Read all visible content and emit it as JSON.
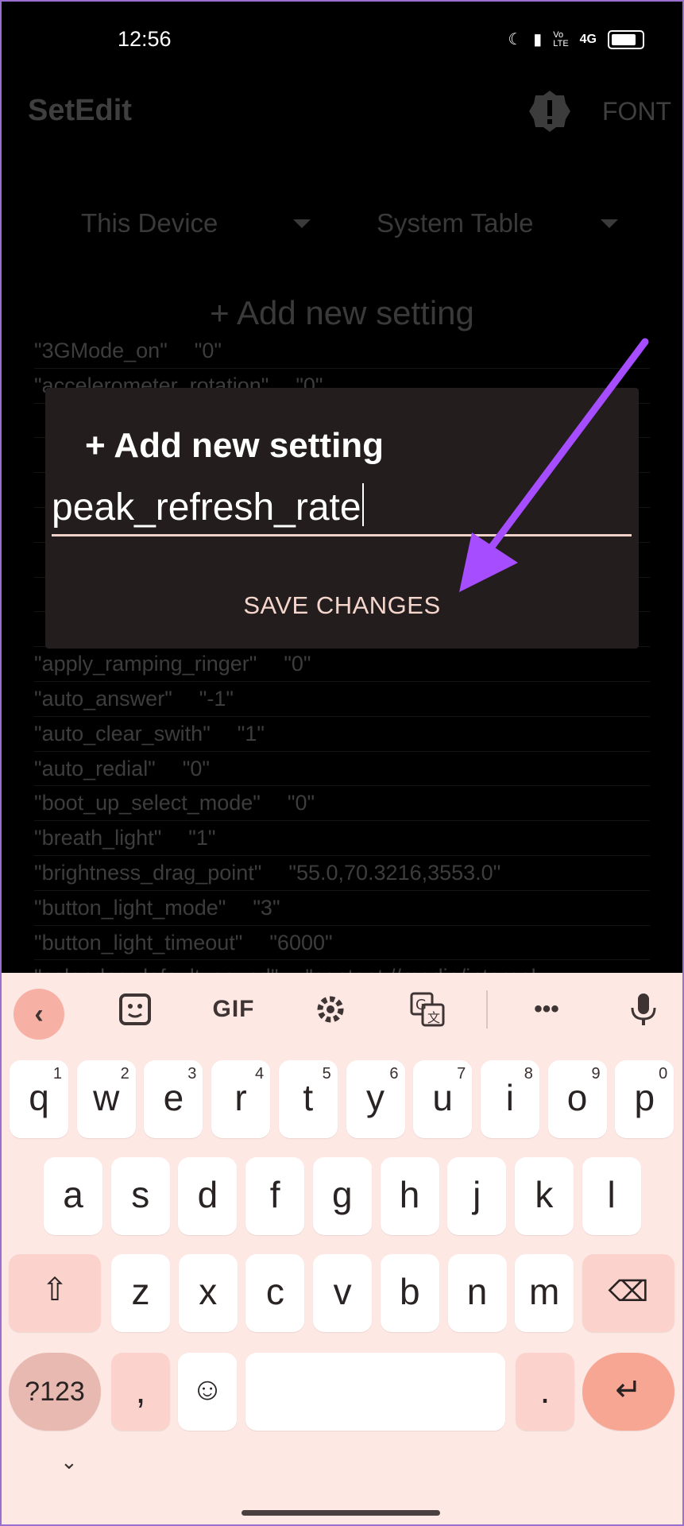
{
  "status": {
    "time": "12:56",
    "network": "4G"
  },
  "app": {
    "title": "SetEdit",
    "font_button": "FONT",
    "device_dropdown": "This Device",
    "table_dropdown": "System Table",
    "add_setting": "+ Add new setting",
    "rows": [
      {
        "key": "\"3GMode_on\"",
        "value": "\"0\""
      },
      {
        "key": "\"accelerometer_rotation\"",
        "value": "\"0\""
      },
      {
        "key": "",
        "value": ""
      },
      {
        "key": "",
        "value": ""
      },
      {
        "key": "",
        "value": ""
      },
      {
        "key": "",
        "value": ""
      },
      {
        "key": "",
        "value": ""
      },
      {
        "key": "",
        "value": ""
      },
      {
        "key": "",
        "value": ""
      },
      {
        "key": "\"apply_ramping_ringer\"",
        "value": "\"0\""
      },
      {
        "key": "\"auto_answer\"",
        "value": "\"-1\""
      },
      {
        "key": "\"auto_clear_swith\"",
        "value": "\"1\""
      },
      {
        "key": "\"auto_redial\"",
        "value": "\"0\""
      },
      {
        "key": "\"boot_up_select_mode\"",
        "value": "\"0\""
      },
      {
        "key": "\"breath_light\"",
        "value": "\"1\""
      },
      {
        "key": "\"brightness_drag_point\"",
        "value": "\"55.0,70.3216,3553.0\""
      },
      {
        "key": "\"button_light_mode\"",
        "value": "\"3\""
      },
      {
        "key": "\"button_light_timeout\"",
        "value": "\"6000\""
      },
      {
        "key": "\"calendar_default_sound\"",
        "value": "\"content://media/internal"
      }
    ]
  },
  "dialog": {
    "title": "+ Add new setting",
    "input_value": "peak_refresh_rate",
    "save_label": "SAVE CHANGES"
  },
  "keyboard": {
    "gif_label": "GIF",
    "row1": [
      {
        "c": "q",
        "h": "1"
      },
      {
        "c": "w",
        "h": "2"
      },
      {
        "c": "e",
        "h": "3"
      },
      {
        "c": "r",
        "h": "4"
      },
      {
        "c": "t",
        "h": "5"
      },
      {
        "c": "y",
        "h": "6"
      },
      {
        "c": "u",
        "h": "7"
      },
      {
        "c": "i",
        "h": "8"
      },
      {
        "c": "o",
        "h": "9"
      },
      {
        "c": "p",
        "h": "0"
      }
    ],
    "row2": [
      "a",
      "s",
      "d",
      "f",
      "g",
      "h",
      "j",
      "k",
      "l"
    ],
    "row3": [
      "z",
      "x",
      "c",
      "v",
      "b",
      "n",
      "m"
    ],
    "symbols_label": "?123",
    "comma": ",",
    "period": "."
  },
  "colors": {
    "accent": "#a64dff",
    "dialog_bg": "#231d1d",
    "keyboard_bg": "#fde8e4",
    "enter_key": "#f8a694"
  }
}
